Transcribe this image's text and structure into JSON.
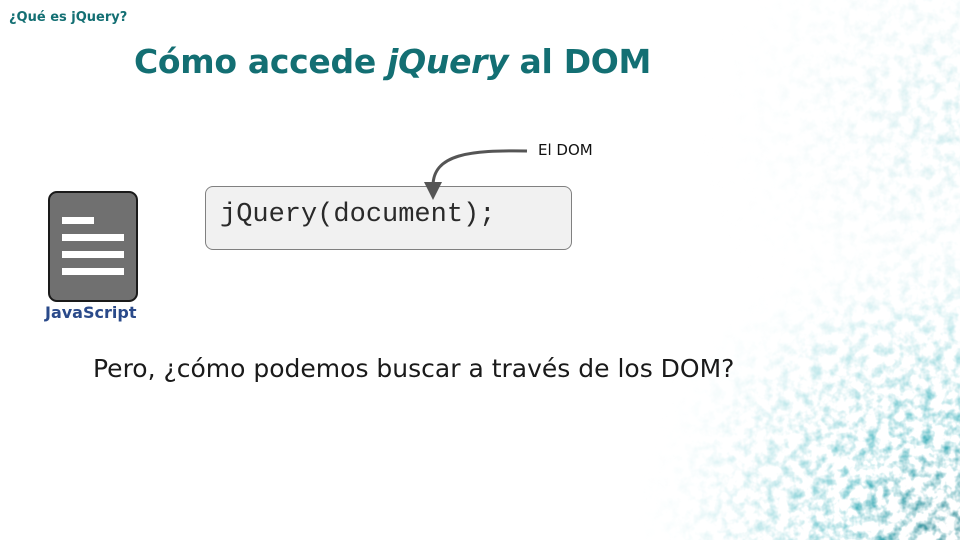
{
  "header": {
    "section_label": "¿Qué es jQuery?"
  },
  "slide": {
    "title_prefix": "Cómo accede ",
    "title_emphasis": "jQuery",
    "title_suffix": " al DOM",
    "code": "jQuery(document);",
    "callout": "El DOM",
    "doc_caption": "JavaScript",
    "question": "Pero, ¿cómo podemos buscar a través de los DOM?"
  },
  "icons": {
    "document": "document-icon",
    "arrow": "curved-arrow-icon"
  },
  "colors": {
    "accent": "#136f73",
    "caption": "#2a4a8a",
    "code_bg": "#f1f1f1",
    "doc_icon": "#707070",
    "texture": "#1aa3b0"
  }
}
